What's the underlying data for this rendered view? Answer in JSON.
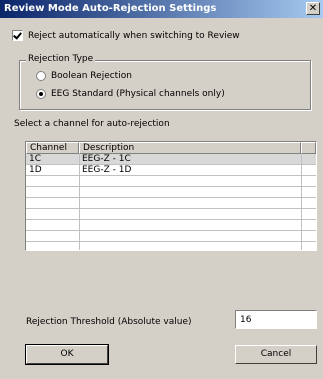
{
  "window": {
    "title": "Review Mode Auto-Rejection Settings",
    "close_glyph": "✕",
    "close_icon": "close-icon"
  },
  "auto_reject": {
    "label": "Reject automatically when switching to Review",
    "checked": true
  },
  "rejection_type": {
    "legend": "Rejection Type",
    "options": [
      {
        "label": "Boolean Rejection",
        "selected": false
      },
      {
        "label": "EEG Standard (Physical channels only)",
        "selected": true
      }
    ]
  },
  "channel_select_label": "Select a channel for auto-rejection",
  "channel_list": {
    "columns": [
      "Channel",
      "Description"
    ],
    "rows": [
      {
        "channel": "1C",
        "description": "EEG-Z - 1C",
        "selected": true
      },
      {
        "channel": "1D",
        "description": "EEG-Z - 1D",
        "selected": false
      }
    ]
  },
  "threshold": {
    "label": "Rejection Threshold (Absolute value)",
    "value": "16"
  },
  "buttons": {
    "ok": "OK",
    "cancel": "Cancel"
  }
}
